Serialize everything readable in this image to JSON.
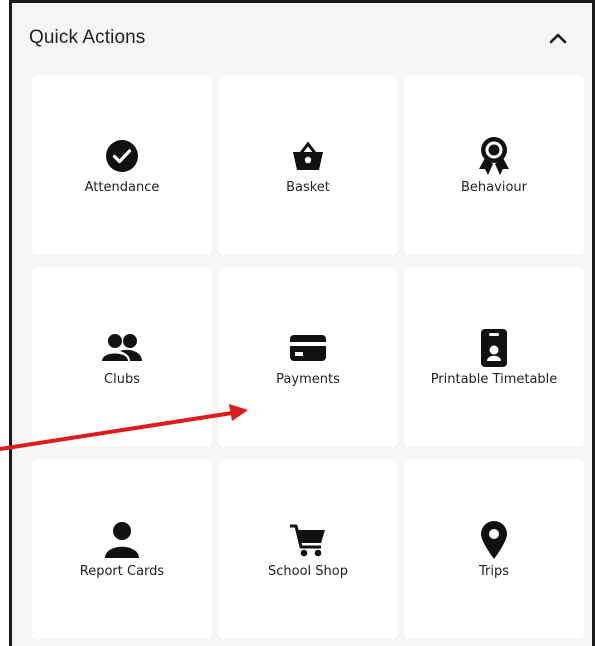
{
  "header": {
    "title": "Quick Actions",
    "collapse_icon": "chevron-up-icon"
  },
  "tiles": [
    {
      "label": "Attendance",
      "icon": "check-circle-icon"
    },
    {
      "label": "Basket",
      "icon": "basket-icon"
    },
    {
      "label": "Behaviour",
      "icon": "award-ribbon-icon"
    },
    {
      "label": "Clubs",
      "icon": "users-icon"
    },
    {
      "label": "Payments",
      "icon": "credit-card-icon"
    },
    {
      "label": "Printable Timetable",
      "icon": "id-badge-icon"
    },
    {
      "label": "Report Cards",
      "icon": "user-icon"
    },
    {
      "label": "School Shop",
      "icon": "shopping-cart-icon"
    },
    {
      "label": "Trips",
      "icon": "map-pin-icon"
    }
  ],
  "annotation": {
    "arrow_color": "#e01b1b"
  }
}
